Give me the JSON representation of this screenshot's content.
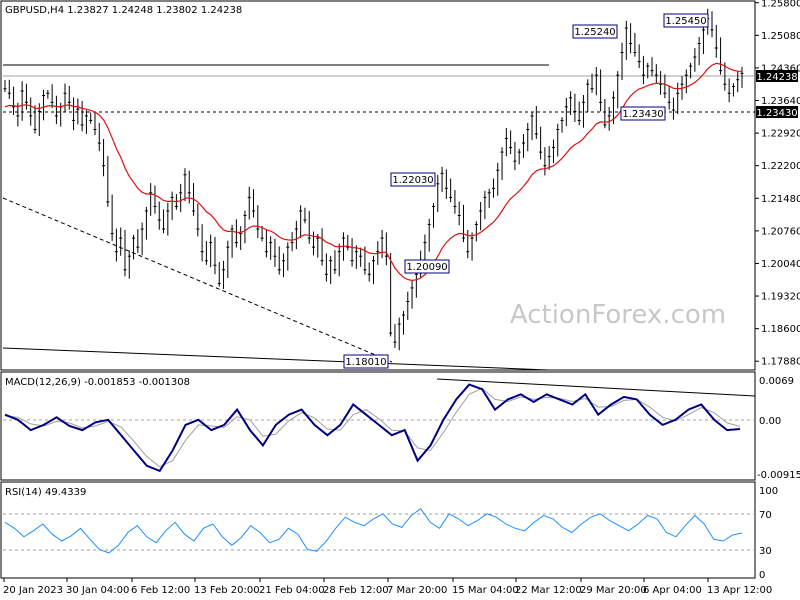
{
  "header": {
    "main": "GBPUSD,H4  1.23827 1.24248 1.23802 1.24238",
    "macd": "MACD(12,26,9) -0.001853 -0.001308",
    "rsi": "RSI(14) 49.4339"
  },
  "watermark": "ActionForex.com",
  "colors": {
    "candle": "#000000",
    "ma": "#e01010",
    "macd_main": "#000080",
    "macd_signal": "#a0a0a0",
    "rsi": "#1e90ff",
    "label_border": "#000080",
    "grid": "#c8c8c8"
  },
  "chart_data": [
    {
      "type": "candlestick",
      "panel": "price",
      "symbol": "GBPUSD",
      "timeframe": "H4",
      "last_values": {
        "open": 1.23827,
        "high": 1.24248,
        "low": 1.23802,
        "close": 1.24238
      },
      "ylim": [
        1.1773,
        1.2575
      ],
      "y_ticks": [
        "1.25800",
        "1.25080",
        "1.24360",
        "1.23640",
        "1.22920",
        "1.22200",
        "1.21480",
        "1.20760",
        "1.20040",
        "1.19320",
        "1.18600",
        "1.17880"
      ],
      "x_ticks": [
        "20 Jan 2023",
        "30 Jan 04:00",
        "6 Feb 12:00",
        "13 Feb 20:00",
        "21 Feb 04:00",
        "28 Feb 12:00",
        "7 Mar 20:00",
        "15 Mar 04:00",
        "22 Mar 12:00",
        "29 Mar 20:00",
        "6 Apr 04:00",
        "13 Apr 12:00"
      ],
      "closes": [
        1.239,
        1.238,
        1.235,
        1.233,
        1.2385,
        1.236,
        1.233,
        1.23,
        1.234,
        1.2375,
        1.238,
        1.236,
        1.233,
        1.235,
        1.238,
        1.236,
        1.232,
        1.2345,
        1.231,
        1.233,
        1.232,
        1.23,
        1.227,
        1.222,
        1.214,
        1.207,
        1.203,
        1.206,
        1.199,
        1.202,
        1.206,
        1.204,
        1.208,
        1.212,
        1.216,
        1.213,
        1.21,
        1.208,
        1.212,
        1.215,
        1.213,
        1.216,
        1.22,
        1.216,
        1.212,
        1.208,
        1.203,
        1.201,
        1.205,
        1.2,
        1.196,
        1.199,
        1.204,
        1.208,
        1.205,
        1.207,
        1.211,
        1.215,
        1.212,
        1.208,
        1.206,
        1.203,
        1.205,
        1.202,
        1.199,
        1.201,
        1.204,
        1.205,
        1.208,
        1.212,
        1.21,
        1.206,
        1.204,
        1.206,
        1.201,
        1.198,
        1.201,
        1.199,
        1.203,
        1.206,
        1.204,
        1.201,
        1.203,
        1.202,
        1.199,
        1.198,
        1.201,
        1.203,
        1.206,
        1.202,
        1.185,
        1.183,
        1.187,
        1.189,
        1.192,
        1.195,
        1.198,
        1.2009,
        1.205,
        1.209,
        1.213,
        1.218,
        1.2203,
        1.217,
        1.215,
        1.213,
        1.211,
        1.206,
        1.203,
        1.206,
        1.209,
        1.212,
        1.215,
        1.216,
        1.217,
        1.221,
        1.225,
        1.228,
        1.226,
        1.223,
        1.225,
        1.227,
        1.23,
        1.233,
        1.229,
        1.225,
        1.222,
        1.224,
        1.226,
        1.23,
        1.232,
        1.235,
        1.237,
        1.234,
        1.232,
        1.236,
        1.24,
        1.239,
        1.242,
        1.236,
        1.231,
        1.233,
        1.237,
        1.242,
        1.247,
        1.2524,
        1.249,
        1.247,
        1.245,
        1.242,
        1.244,
        1.243,
        1.242,
        1.24,
        1.238,
        1.236,
        1.2343,
        1.238,
        1.24,
        1.242,
        1.244,
        1.246,
        1.249,
        1.252,
        1.2545,
        1.252,
        1.248,
        1.243,
        1.24,
        1.238,
        1.2395,
        1.241,
        1.2424
      ],
      "moving_average_color": "#e01010",
      "annotations": [
        "1.25240",
        "1.25450",
        "1.22030",
        "1.20090",
        "1.23430",
        "1.18010"
      ],
      "current_price_label": "1.24238",
      "level_label": "1.23430",
      "trendlines": [
        "upper horizontal",
        "lower support",
        "dashed falling"
      ]
    },
    {
      "type": "line",
      "panel": "macd",
      "name": "MACD(12,26,9)",
      "values": {
        "main": -0.001853,
        "signal": -0.001308
      },
      "ylim": [
        -0.011,
        0.008
      ],
      "y_ticks": [
        "0.0069",
        "0.00",
        "-0.009158"
      ],
      "series": [
        {
          "name": "main",
          "values": [
            0.001,
            0.0,
            -0.002,
            -0.001,
            0.0005,
            -0.0012,
            -0.002,
            -0.0005,
            0.0,
            -0.003,
            -0.006,
            -0.009,
            -0.01,
            -0.006,
            -0.001,
            0.0,
            -0.002,
            -0.001,
            0.002,
            -0.002,
            -0.005,
            -0.001,
            0.001,
            0.002,
            -0.001,
            -0.003,
            -0.001,
            0.003,
            0.001,
            -0.001,
            -0.003,
            -0.002,
            -0.008,
            -0.005,
            0.0,
            0.004,
            0.0069,
            0.006,
            0.002,
            0.004,
            0.005,
            0.0035,
            0.005,
            0.004,
            0.003,
            0.005,
            0.001,
            0.003,
            0.0045,
            0.004,
            0.001,
            -0.001,
            0.0,
            0.002,
            0.003,
            0.0,
            -0.002,
            -0.0018
          ]
        },
        {
          "name": "signal",
          "values": [
            0.0008,
            0.0005,
            -0.0008,
            -0.0012,
            -0.0003,
            -0.0006,
            -0.0016,
            -0.0012,
            -0.0003,
            -0.0014,
            -0.0042,
            -0.0072,
            -0.0092,
            -0.008,
            -0.004,
            -0.001,
            -0.0012,
            -0.0015,
            0.0006,
            0.0,
            -0.0032,
            -0.0028,
            -0.0002,
            0.0014,
            0.0004,
            -0.0018,
            -0.002,
            0.001,
            0.002,
            0.0002,
            -0.002,
            -0.0022,
            -0.0055,
            -0.006,
            -0.0025,
            0.0015,
            0.005,
            0.0062,
            0.004,
            0.0036,
            0.0045,
            0.004,
            0.0044,
            0.0042,
            0.0036,
            0.0042,
            0.0025,
            0.0026,
            0.0038,
            0.004,
            0.0025,
            0.0005,
            -0.0002,
            0.001,
            0.0024,
            0.0014,
            -0.0006,
            -0.0013
          ]
        }
      ],
      "trendline": "falling from 0.0069"
    },
    {
      "type": "line",
      "panel": "rsi",
      "name": "RSI(14)",
      "value": 49.4339,
      "ylim": [
        0,
        100
      ],
      "y_ticks": [
        "100",
        "70",
        "30",
        "0"
      ],
      "levels": [
        70,
        30
      ],
      "series": [
        {
          "name": "RSI",
          "values": [
            62,
            55,
            45,
            52,
            60,
            48,
            40,
            46,
            55,
            42,
            30,
            26,
            35,
            50,
            58,
            45,
            38,
            52,
            62,
            48,
            40,
            55,
            60,
            45,
            35,
            44,
            58,
            50,
            38,
            42,
            55,
            48,
            30,
            28,
            40,
            55,
            68,
            62,
            58,
            66,
            72,
            60,
            56,
            70,
            78,
            62,
            55,
            72,
            66,
            58,
            64,
            72,
            68,
            60,
            55,
            52,
            62,
            70,
            66,
            56,
            50,
            60,
            68,
            72,
            64,
            58,
            52,
            60,
            70,
            66,
            50,
            45,
            58,
            70,
            60,
            42,
            40,
            47,
            49.4
          ]
        }
      ]
    }
  ]
}
